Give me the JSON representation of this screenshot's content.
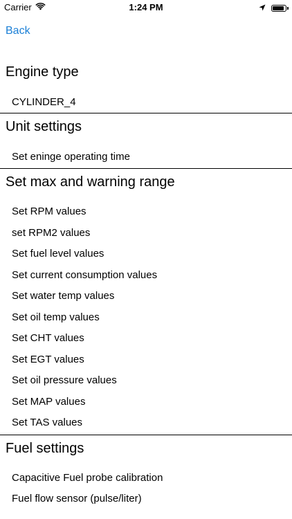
{
  "status_bar": {
    "carrier": "Carrier",
    "time": "1:24 PM",
    "battery_level": 0.9,
    "icons": [
      "wifi-icon",
      "location-arrow-icon",
      "battery-icon"
    ]
  },
  "nav": {
    "back_label": "Back"
  },
  "sections": {
    "engine_type": {
      "title": "Engine type",
      "items": [
        "CYLINDER_4"
      ]
    },
    "unit_settings": {
      "title": "Unit settings",
      "items": [
        "Set eninge operating time"
      ]
    },
    "max_warning": {
      "title": "Set max and warning range",
      "items": [
        "Set RPM values",
        "set RPM2 values",
        "Set fuel level values",
        "Set current consumption values",
        "Set water temp values",
        "Set oil temp values",
        "Set CHT values",
        "Set EGT values",
        "Set oil pressure values",
        "Set MAP values",
        "Set TAS values"
      ]
    },
    "fuel_settings": {
      "title": "Fuel settings",
      "items": [
        "Capacitive Fuel probe calibration",
        "Fuel flow sensor (pulse/liter)"
      ]
    }
  },
  "colors": {
    "link": "#1a7fd6",
    "text": "#000000",
    "background": "#ffffff"
  }
}
